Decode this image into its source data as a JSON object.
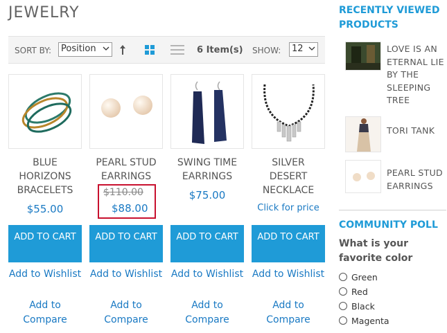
{
  "page": {
    "title": "JEWELRY"
  },
  "toolbar": {
    "sort_label": "SORT BY:",
    "sort_value": "Position",
    "item_count": "6 Item(s)",
    "show_label": "SHOW:",
    "show_value": "12",
    "view_mode_active": "grid",
    "colors": {
      "active_view": "#1f9bd7",
      "inactive_view": "#b3b3b3"
    }
  },
  "products": [
    {
      "name": "BLUE HORIZONS BRACELETS",
      "price": "$55.00",
      "add_to_cart": "ADD TO CART",
      "wishlist": "Add to Wishlist",
      "compare": "Add to Compare",
      "image_icon": "bracelets-image"
    },
    {
      "name": "PEARL STUD EARRINGS",
      "old_price": "$110.00",
      "special_price": "$88.00",
      "add_to_cart": "ADD TO CART",
      "wishlist": "Add to Wishlist",
      "compare": "Add to Compare",
      "image_icon": "pearl-earrings-image"
    },
    {
      "name": "SWING TIME EARRINGS",
      "price": "$75.00",
      "add_to_cart": "ADD TO CART",
      "wishlist": "Add to Wishlist",
      "compare": "Add to Compare",
      "image_icon": "drop-earrings-image"
    },
    {
      "name": "SILVER DESERT NECKLACE",
      "price_link": "Click for price",
      "add_to_cart": "ADD TO CART",
      "wishlist": "Add to Wishlist",
      "compare": "Add to Compare",
      "image_icon": "necklace-image"
    }
  ],
  "sidebar": {
    "recently_viewed": {
      "title": "RECENTLY VIEWED PRODUCTS",
      "items": [
        {
          "name": "LOVE IS AN ETERNAL LIE BY THE SLEEPING TREE",
          "image_icon": "album-cover-image"
        },
        {
          "name": "TORI TANK",
          "image_icon": "tank-top-image"
        },
        {
          "name": "PEARL STUD EARRINGS",
          "image_icon": "pearl-earrings-image"
        }
      ]
    },
    "poll": {
      "title": "COMMUNITY POLL",
      "question": "What is your favorite color",
      "options": [
        "Green",
        "Red",
        "Black",
        "Magenta"
      ]
    }
  },
  "colors": {
    "accent": "#1f9bd7",
    "link": "#1979c3",
    "highlight_border": "#c8102e"
  }
}
